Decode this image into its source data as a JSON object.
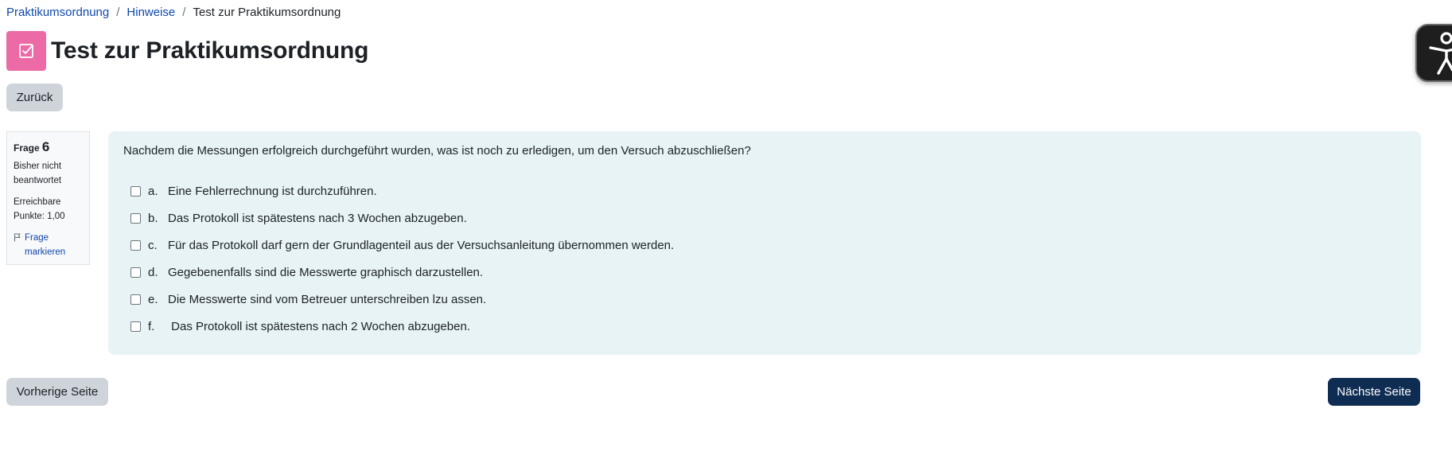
{
  "breadcrumb": {
    "items": [
      "Praktikumsordnung",
      "Hinweise"
    ],
    "separator": "/",
    "current": "Test zur Praktikumsordnung"
  },
  "page": {
    "title": "Test zur Praktikumsordnung",
    "icon": "quiz-checkbox-icon",
    "icon_color": "#ec6aa6"
  },
  "buttons": {
    "back": "Zurück",
    "prev": "Vorherige Seite",
    "next": "Nächste Seite"
  },
  "question_info": {
    "label": "Frage",
    "number": "6",
    "status": "Bisher nicht beantwortet",
    "points": "Erreichbare Punkte: 1,00",
    "flag": "Frage markieren"
  },
  "question": {
    "text": "Nachdem die Messungen erfolgreich durchgeführt wurden, was ist noch zu erledigen, um den Versuch abzuschließen?",
    "answers": [
      {
        "letter": "a.",
        "text": "Eine Fehlerrechnung ist durchzuführen."
      },
      {
        "letter": "b.",
        "text": "Das Protokoll ist spätestens nach 3 Wochen abzugeben."
      },
      {
        "letter": "c.",
        "text": "Für das Protokoll darf gern der Grundlagenteil aus der Versuchsanleitung übernommen werden."
      },
      {
        "letter": "d.",
        "text": "Gegebenenfalls sind die Messwerte graphisch darzustellen."
      },
      {
        "letter": "e.",
        "text": "Die Messwerte sind vom Betreuer unterschreiben lzu assen."
      },
      {
        "letter": "f.",
        "text": " Das Protokoll ist spätestens nach 2 Wochen abzugeben."
      }
    ]
  },
  "colors": {
    "primary": "#0f2d53",
    "link": "#0f47ad",
    "content_bg": "#e7f3f5",
    "secondary_btn": "#ced4da"
  },
  "accessibility_widget": {
    "icon": "accessibility-person-icon"
  }
}
